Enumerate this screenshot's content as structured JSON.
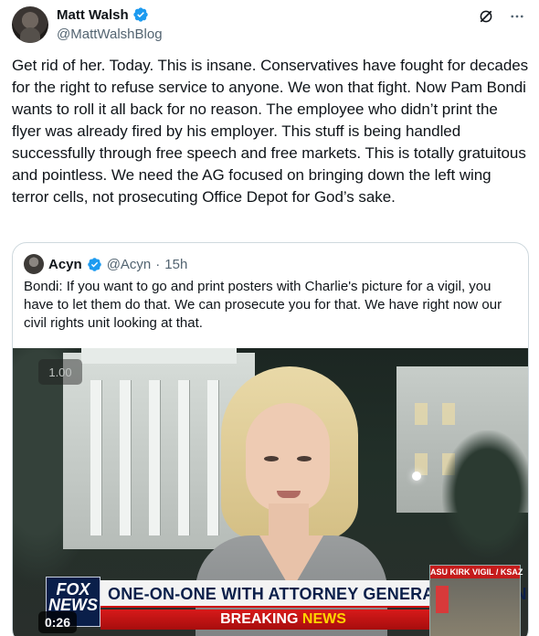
{
  "author": {
    "display_name": "Matt Walsh",
    "handle": "@MattWalshBlog",
    "verified": true
  },
  "post_text": "Get rid of her. Today. This is insane. Conservatives have fought for decades for the right to refuse service to anyone. We won that fight. Now Pam Bondi wants to roll it all back for no reason. The employee who didn’t print the flyer was already fired by his employer. This stuff is being handled successfully through free speech and free markets. This is totally gratuitous and pointless. We need the AG focused on bringing down the left wing terror cells, not prosecuting Office Depot for God’s sake.",
  "quoted_post": {
    "display_name": "Acyn",
    "handle": "@Acyn",
    "separator": "·",
    "time": "15h",
    "verified": true,
    "text": "Bondi: If you want to go and print posters with Charlie's picture for a vigil, you have to let them do that. We can prosecute you for that. We have right now our civil rights unit looking at that."
  },
  "video": {
    "playback_speed": "1.00",
    "timestamp": "0:26",
    "lower_third_headline": "ONE-ON-ONE WITH ATTORNEY GENERAL PAM BONDI",
    "breaking_prefix": "BREAKING",
    "breaking_suffix": "NEWS",
    "network_logo_text": "FOX NEWS",
    "inset_label": "ASU KIRK VIGIL / KSAZ"
  },
  "icons": {
    "verified": "verified-badge-icon",
    "grok": "grok-icon",
    "more": "more-options-icon"
  },
  "colors": {
    "verified_blue": "#1d9bf0",
    "text_primary": "#0f1419",
    "text_secondary": "#536471",
    "border": "#cfd9de",
    "breaking_red": "#c11111"
  }
}
